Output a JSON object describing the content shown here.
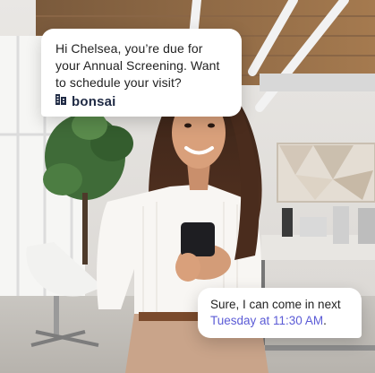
{
  "message_top": {
    "text": "Hi Chelsea, you’re due for your Annual Screening. Want to schedule your visit?",
    "brand": "bonsai",
    "brand_icon": "building-logo-icon"
  },
  "message_reply": {
    "text_prefix": "Sure, I can come in next",
    "text_highlight": "Tuesday at 11:30 AM",
    "text_suffix": "."
  },
  "colors": {
    "accent": "#5b5bd6",
    "brand_dark": "#1f2a44",
    "bubble_bg": "#ffffff"
  }
}
